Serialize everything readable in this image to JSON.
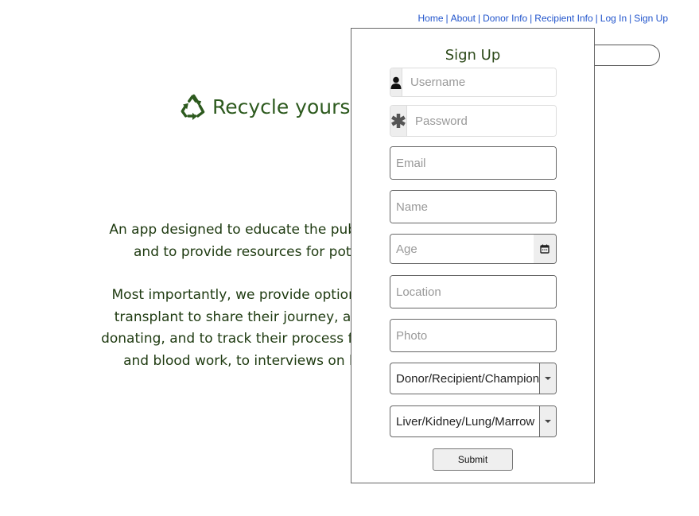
{
  "nav": {
    "links": [
      "Home",
      "About",
      "Donor Info",
      "Recipient Info",
      "Log In",
      "Sign Up"
    ],
    "separator": "|"
  },
  "hero": {
    "icon": "recycle-icon",
    "title": "Recycle yours",
    "brand_color": "#2d5a1e"
  },
  "description": {
    "p1_lines": [
      "An app designed to educate the public o",
      "and to provide resources for pote"
    ],
    "p2_lines": [
      "Most importantly, we provide options fo",
      "transplant to share their journey, ask q",
      "donating, and to track their process from e",
      "and blood work, to interviews on life"
    ]
  },
  "signup": {
    "title": "Sign Up",
    "username": {
      "icon": "user-icon",
      "placeholder": "Username",
      "value": ""
    },
    "password": {
      "icon": "asterisk-icon",
      "placeholder": "Password",
      "value": ""
    },
    "email": {
      "placeholder": "Email",
      "value": ""
    },
    "name": {
      "placeholder": "Name",
      "value": ""
    },
    "age": {
      "placeholder": "Age",
      "value": "",
      "icon": "calendar-icon"
    },
    "location": {
      "placeholder": "Location",
      "value": ""
    },
    "photo": {
      "placeholder": "Photo",
      "value": ""
    },
    "role_select": {
      "selected": "Donor/Recipient/Champion"
    },
    "organ_select": {
      "selected": "Liver/Kidney/Lung/Marrow"
    },
    "submit_label": "Submit"
  }
}
